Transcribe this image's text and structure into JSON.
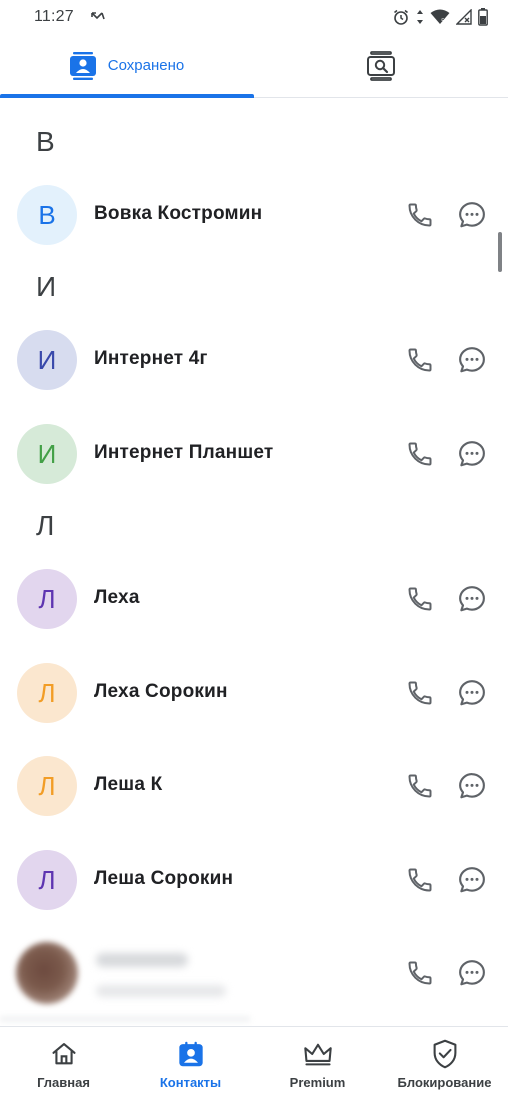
{
  "status_bar": {
    "time": "11:27",
    "left_icon": "missed-call-icon",
    "right_icons": [
      "alarm-icon",
      "data-arrows-icon",
      "wifi-icon",
      "signal-icon",
      "battery-icon"
    ]
  },
  "tabs": [
    {
      "label": "Сохранено",
      "icon": "contact-card-icon",
      "active": true
    },
    {
      "label": "",
      "icon": "contact-search-icon",
      "active": false
    }
  ],
  "sections": [
    {
      "letter": "В",
      "contacts": [
        {
          "initial": "В",
          "name": "Вовка Костромин",
          "bg": "#e3f1fc",
          "fg": "#1a73e8"
        }
      ]
    },
    {
      "letter": "И",
      "contacts": [
        {
          "initial": "И",
          "name": "Интернет 4г",
          "bg": "#d7dcef",
          "fg": "#3949ab"
        },
        {
          "initial": "И",
          "name": "Интернет Планшет",
          "bg": "#d6ead8",
          "fg": "#43a047"
        }
      ]
    },
    {
      "letter": "Л",
      "contacts": [
        {
          "initial": "Л",
          "name": "Леха",
          "bg": "#e2d6ee",
          "fg": "#5e35b1"
        },
        {
          "initial": "Л",
          "name": "Леха Сорокин",
          "bg": "#fbe7cf",
          "fg": "#f29d26"
        },
        {
          "initial": "Л",
          "name": "Леша К",
          "bg": "#fbe7cf",
          "fg": "#f29d26"
        },
        {
          "initial": "Л",
          "name": "Леша Сорокин",
          "bg": "#e2d6ee",
          "fg": "#5e35b1"
        }
      ]
    }
  ],
  "row_actions": {
    "call_icon": "phone-icon",
    "message_icon": "message-icon"
  },
  "bottom_nav": [
    {
      "label": "Главная",
      "icon": "home-icon",
      "active": false
    },
    {
      "label": "Контакты",
      "icon": "contacts-icon",
      "active": true
    },
    {
      "label": "Premium",
      "icon": "crown-icon",
      "active": false
    },
    {
      "label": "Блокирование",
      "icon": "shield-check-icon",
      "active": false
    }
  ],
  "colors": {
    "accent": "#1a73e8",
    "icon": "#5f6368",
    "divider": "#e2e5ea"
  }
}
